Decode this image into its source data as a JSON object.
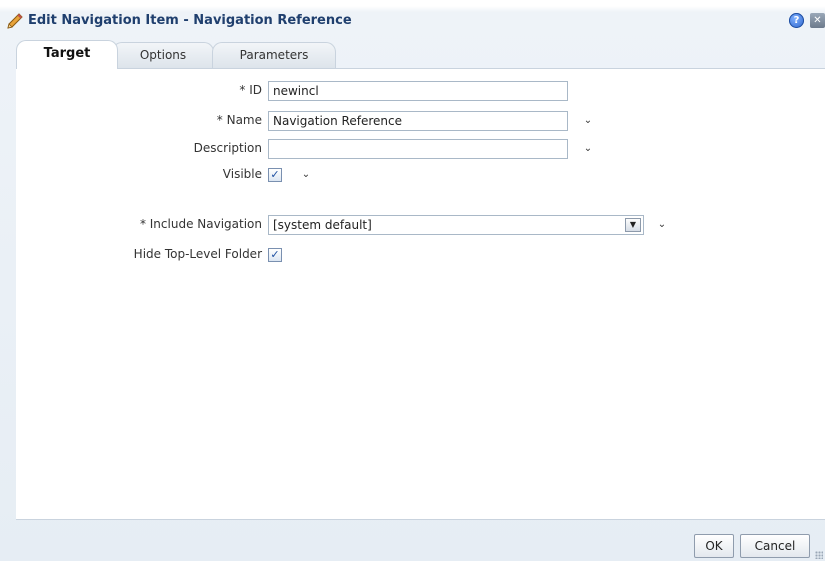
{
  "dialog": {
    "title": "Edit Navigation Item - Navigation Reference",
    "help_glyph": "?",
    "close_glyph": "✕"
  },
  "tabs": [
    {
      "label": "Target",
      "active": true
    },
    {
      "label": "Options",
      "active": false
    },
    {
      "label": "Parameters",
      "active": false
    }
  ],
  "form": {
    "id": {
      "label": "* ID",
      "value": "newincl"
    },
    "name": {
      "label": "* Name",
      "value": "Navigation Reference"
    },
    "description": {
      "label": "Description",
      "value": ""
    },
    "visible": {
      "label": "Visible",
      "checked": true,
      "check_glyph": "✓"
    },
    "include_navigation": {
      "label": "* Include Navigation",
      "value": "[system default]"
    },
    "hide_top_level_folder": {
      "label": "Hide Top-Level Folder",
      "checked": true,
      "check_glyph": "✓"
    }
  },
  "chevron_glyph": "⌄",
  "dropdown_glyph": "▼",
  "buttons": {
    "ok": "OK",
    "cancel": "Cancel"
  },
  "colors": {
    "title": "#1f3f6e",
    "panel_border": "#c9d3de",
    "dialog_background": "#e6edf4"
  }
}
